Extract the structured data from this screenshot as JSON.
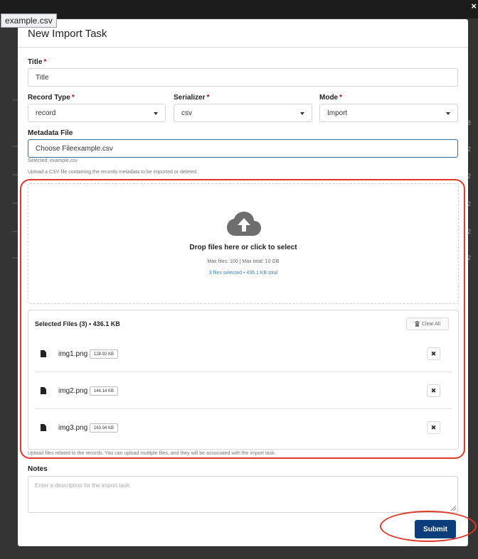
{
  "tooltip": {
    "text": "example.csv"
  },
  "modal": {
    "title": "New Import Task"
  },
  "form": {
    "title_label": "Title",
    "title_value": "Title",
    "record_type_label": "Record Type",
    "record_type_value": "record",
    "serializer_label": "Serializer",
    "serializer_value": "csv",
    "mode_label": "Mode",
    "mode_value": "Import",
    "metadata_label": "Metadata File",
    "metadata_value": "Choose Fileexample.csv",
    "metadata_selected": "Selected: example.csv",
    "metadata_help": "Upload a CSV file containing the records metadata to be imported or deleted.",
    "required_mark": "*"
  },
  "upload": {
    "drop_text": "Drop files here or click to select",
    "limits": "Max files: 100 | Max total: 10 GB",
    "summary": "3 files selected • 436.1 KB total",
    "icon": "cloud-upload-icon"
  },
  "files": {
    "header": "Selected Files (3) • 436.1 KB",
    "clear_label": "Clear All",
    "items": [
      {
        "name": "img1.png",
        "size": "128.92 KB"
      },
      {
        "name": "img2.png",
        "size": "144.14 KB"
      },
      {
        "name": "img3.png",
        "size": "163.04 KB"
      }
    ],
    "help": "Upload files related to the records. You can upload multiple files, and they will be associated with the import task."
  },
  "notes": {
    "label": "Notes",
    "placeholder": "Enter a description for the import task."
  },
  "actions": {
    "submit_label": "Submit"
  },
  "background": {
    "close_glyph": "×",
    "digits": [
      "8",
      "2",
      "2",
      "2",
      "2",
      "2"
    ]
  },
  "colors": {
    "primary": "#0a3d7a",
    "annotation": "#e03a2a",
    "link": "#3a86c8",
    "required": "#d0021b"
  }
}
